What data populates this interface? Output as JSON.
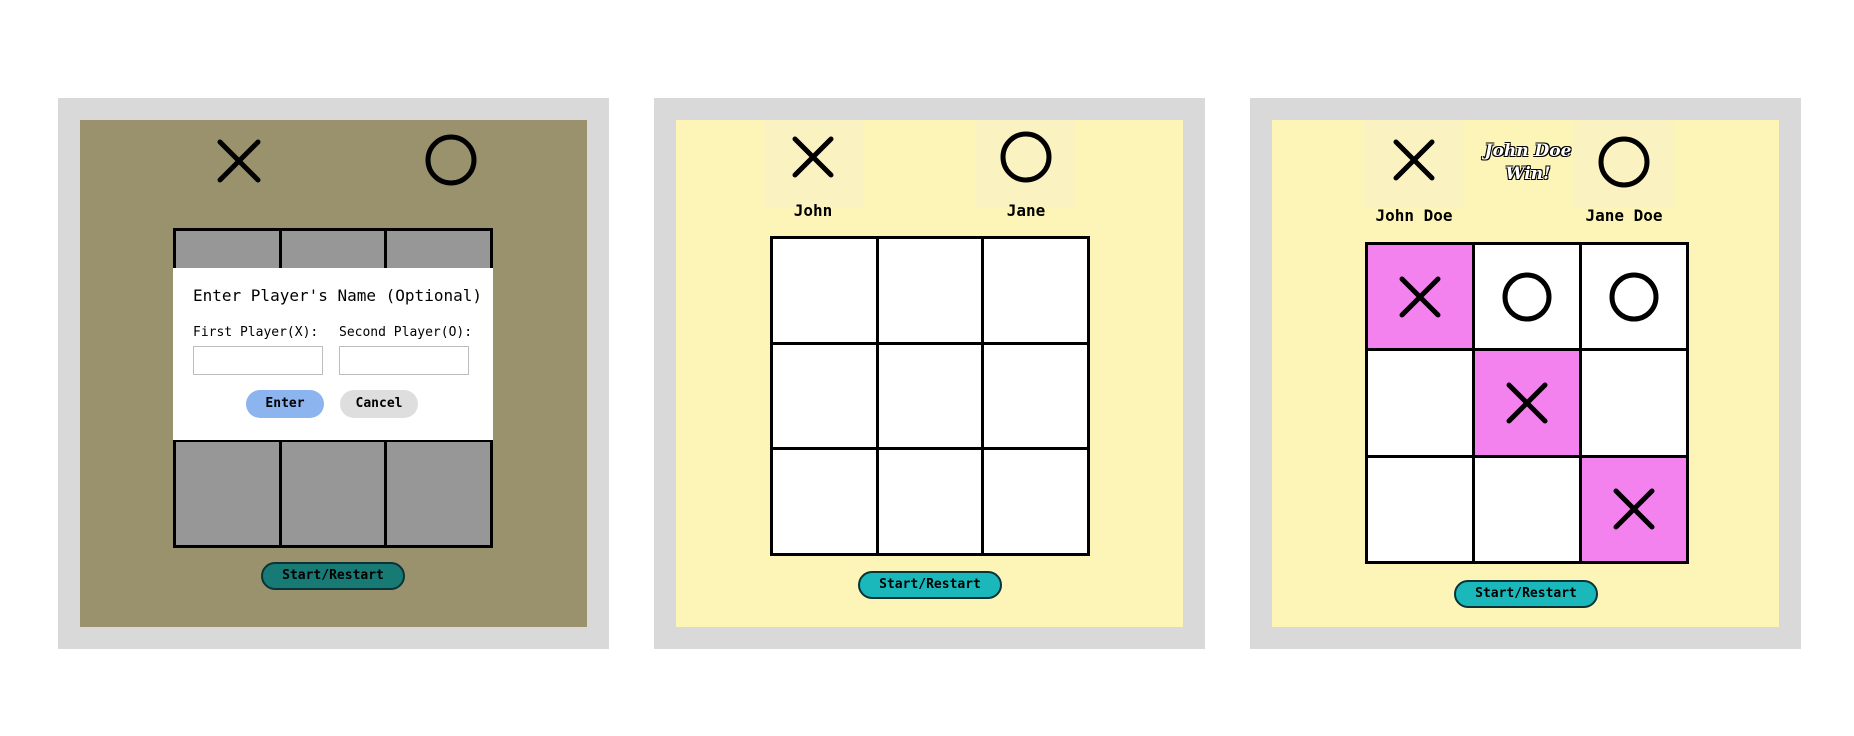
{
  "panels": [
    {
      "id": "name-dialog",
      "dialog": {
        "title": "Enter Player's Name (Optional)",
        "first_label": "First Player(X):",
        "second_label": "Second Player(O):",
        "first_value": "",
        "second_value": "",
        "enter_label": "Enter",
        "cancel_label": "Cancel"
      },
      "player_x_icon": "x-icon",
      "player_o_icon": "o-icon",
      "board": [
        "",
        "",
        "",
        "",
        "",
        "",
        "",
        "",
        ""
      ],
      "start_label": "Start/Restart"
    },
    {
      "id": "game-start",
      "player_x_name": "John",
      "player_o_name": "Jane",
      "player_x_icon": "x-icon",
      "player_o_icon": "o-icon",
      "board": [
        "",
        "",
        "",
        "",
        "",
        "",
        "",
        "",
        ""
      ],
      "start_label": "Start/Restart"
    },
    {
      "id": "game-won",
      "player_x_name": "John Doe",
      "player_o_name": "Jane Doe",
      "winner_message": "John Doe Win!",
      "player_x_icon": "x-icon",
      "player_o_icon": "o-icon",
      "board": [
        "X",
        "O",
        "O",
        "",
        "X",
        "",
        "",
        "",
        "X"
      ],
      "winning_cells": [
        0,
        4,
        8
      ],
      "start_label": "Start/Restart"
    }
  ],
  "colors": {
    "frame": "#d9d9d9",
    "board_bg": "#fdf5b7",
    "overlay_bg": "#99926d",
    "win_cell": "#f482ee",
    "button": "#1ab8ba",
    "enter_button": "#8cb4ee"
  }
}
